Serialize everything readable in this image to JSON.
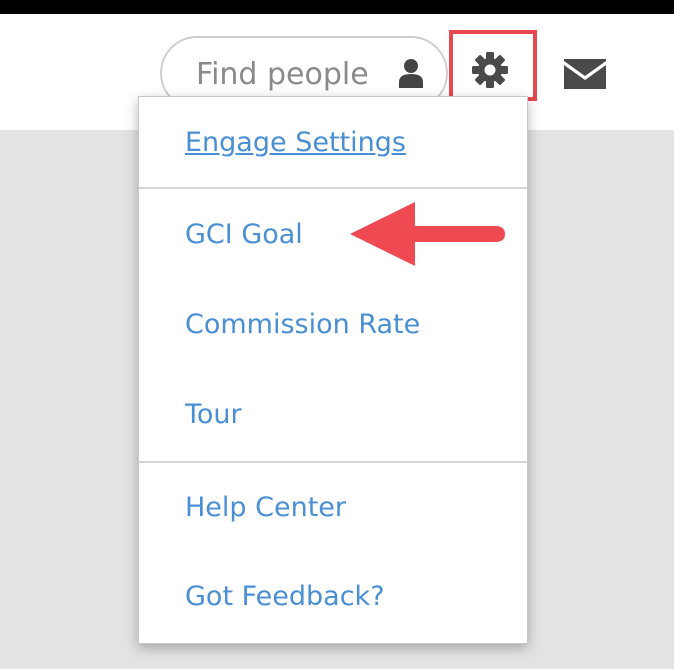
{
  "search": {
    "placeholder": "Find people",
    "icon": "person-icon"
  },
  "toolbar": {
    "settings_icon": "gear-icon",
    "messages_icon": "envelope-icon",
    "highlight_color": "#e8484f"
  },
  "settings_menu": {
    "items": [
      {
        "label": "Engage Settings"
      },
      {
        "label": "GCI Goal"
      },
      {
        "label": "Commission Rate"
      },
      {
        "label": "Tour"
      },
      {
        "label": "Help Center"
      },
      {
        "label": "Got Feedback?"
      }
    ],
    "link_color": "#4a8fd4"
  },
  "annotation": {
    "icon": "arrow-left-icon",
    "color": "#ef4a52"
  }
}
